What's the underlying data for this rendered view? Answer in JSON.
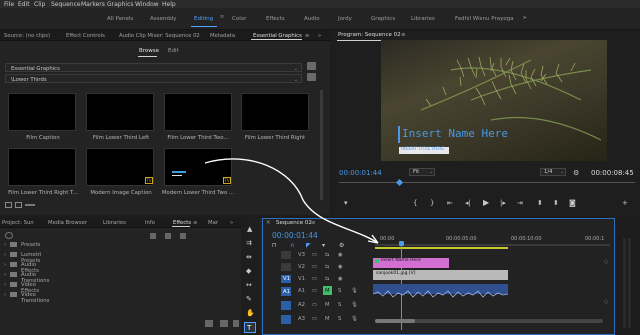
{
  "menu": [
    "File",
    "Edit",
    "Clip",
    "Sequence",
    "Markers",
    "Graphics",
    "Window",
    "Help"
  ],
  "workspaces": {
    "items": [
      "All Panels",
      "Assembly",
      "Editing",
      "Color",
      "Effects",
      "Audio",
      "Jordy",
      "Graphics",
      "Libraries",
      "Fadhil Wisnu Prayoga"
    ],
    "active": "Editing",
    "overflow": "»"
  },
  "left_tabs": [
    "Source: (no clips)",
    "Effect Controls",
    "Audio Clip Mixer: Sequence 02",
    "Metadata",
    "Essential Graphics"
  ],
  "left_tabs_active": "Essential Graphics",
  "eg": {
    "browse_label": "Browse",
    "edit_label": "Edit",
    "dropdown1": "Essential Graphics",
    "dropdown2": "\\Lower Thirds",
    "templates": [
      {
        "caption": "Film Caption"
      },
      {
        "caption": "Film Lower Third Left"
      },
      {
        "caption": "Film Lower Third Two..."
      },
      {
        "caption": "Film Lower Third Right"
      },
      {
        "caption": "Film Lower Third Right T..."
      },
      {
        "caption": "Modern Image Caption"
      },
      {
        "caption": "Modern Lower Third Two ..."
      }
    ]
  },
  "program": {
    "title": "Program: Sequence 02",
    "timecode": "00:00:01:44",
    "fit": "Fit",
    "quality": "1/4",
    "duration": "00:00:08:45",
    "overlay_name": "Insert Name Here",
    "overlay_sub": "INSERT TITLE HERE"
  },
  "project_tabs": [
    "Project: Sun",
    "Media Browser",
    "Libraries",
    "Info",
    "Effects",
    "Mar"
  ],
  "project_tabs_active": "Effects",
  "effects_list": [
    "Presets",
    "Lumetri Presets",
    "Audio Effects",
    "Audio Transitions",
    "Video Effects",
    "Video Transitions"
  ],
  "timeline": {
    "sequence": "Sequence 02",
    "timecode": "00:00:01:44",
    "ruler": [
      "00:00",
      "00:00:05:00",
      "00:00:10:00",
      "00:00:1"
    ],
    "video_tracks": [
      "V3",
      "V2",
      "V1"
    ],
    "audio_tracks": [
      "A1",
      "A2",
      "A3"
    ],
    "clip_v2": "Insert Name Here",
    "clip_v1": "sanjook01.jpg [V]"
  },
  "colors": {
    "accent": "#4fa0ff",
    "timecode": "#4a98e6",
    "clip_pink": "#d36fd3",
    "clip_gray": "#b9b9b9",
    "clip_blue": "#2f4f8e"
  }
}
